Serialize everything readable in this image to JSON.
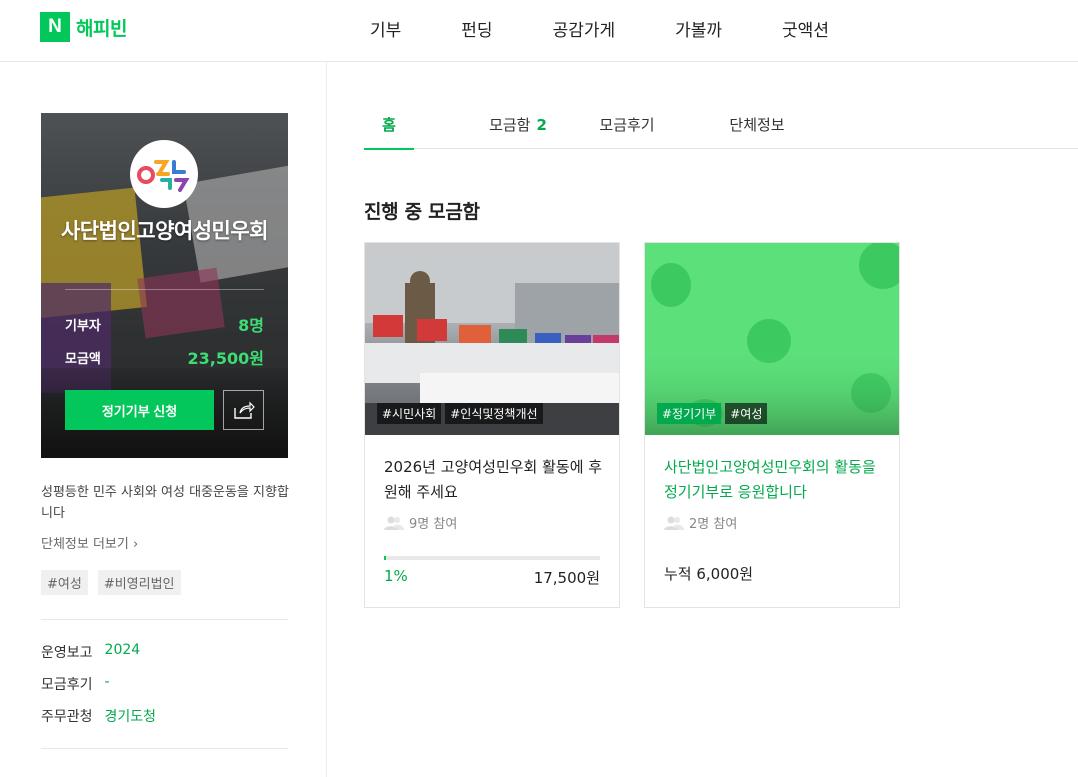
{
  "header": {
    "logo_letter": "N",
    "logo_text": "해피빈",
    "menu": [
      "기부",
      "펀딩",
      "공감가게",
      "가볼까",
      "굿액션"
    ]
  },
  "profile": {
    "org_name": "사단법인고양여성민우회",
    "donors_label": "기부자",
    "donors_value": "8명",
    "amount_label": "모금액",
    "amount_value": "23,500원",
    "regular_button": "정기기부 신청",
    "description": "성평등한 민주 사회와 여성 대중운동을 지향합니다",
    "more_link": "단체정보 더보기 ›",
    "tags": [
      "#여성",
      "#비영리법인"
    ],
    "info": [
      {
        "label": "운영보고",
        "value": "2024"
      },
      {
        "label": "모금후기",
        "value": "-"
      },
      {
        "label": "주무관청",
        "value": "경기도청"
      }
    ]
  },
  "tabs": [
    {
      "label": "홈",
      "count": ""
    },
    {
      "label": "모금함",
      "count": "2"
    },
    {
      "label": "모금후기",
      "count": ""
    },
    {
      "label": "단체정보",
      "count": ""
    }
  ],
  "section_title": "진행 중 모금함",
  "cards": [
    {
      "tags": [
        "#시민사회",
        "#인식및정책개선"
      ],
      "title": "2026년 고양여성민우회 활동에 후원해 주세요",
      "participants": "9명 참여",
      "progress_percent": 1,
      "percent_label": "1%",
      "amount": "17,500원"
    },
    {
      "tags": [
        "#정기기부",
        "#여성"
      ],
      "title": "사단법인고양여성민우회의 활동을 정기기부로 응원합니다",
      "participants": "2명 참여",
      "accumulated": "누적 6,000원"
    }
  ],
  "colors": {
    "brand": "#03c75a",
    "brand_text": "#03a94d"
  }
}
